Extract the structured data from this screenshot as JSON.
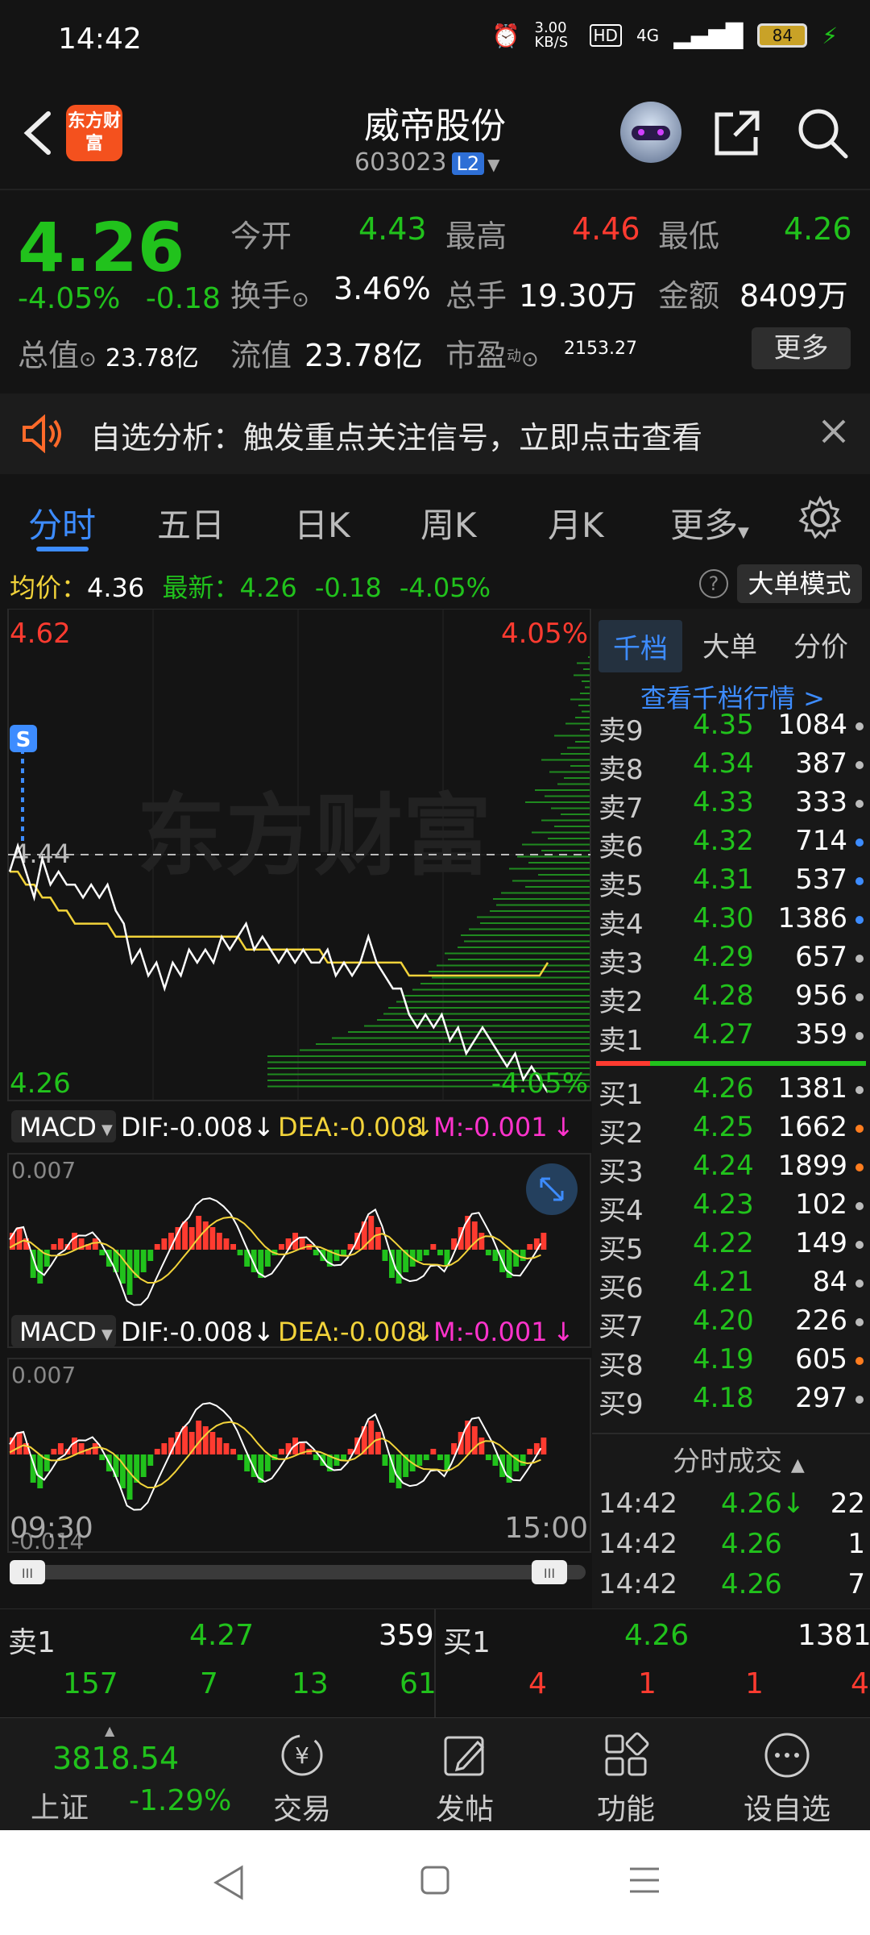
{
  "status_bar": {
    "time": "14:42",
    "net_speed": "3.00 KB/S",
    "hd": "HD",
    "signal": "4G",
    "battery": "84"
  },
  "header": {
    "logo_text": "东方财富",
    "stock_name": "威帝股份",
    "stock_code": "603023",
    "level_badge": "L2"
  },
  "quote": {
    "price": "4.26",
    "change_pct": "-4.05%",
    "change_amt": "-0.18",
    "open_label": "今开",
    "open": "4.43",
    "high_label": "最高",
    "high": "4.46",
    "low_label": "最低",
    "low": "4.26",
    "turnover_label": "换手",
    "turnover": "3.46%",
    "volume_label": "总手",
    "volume": "19.30万",
    "amount_label": "金额",
    "amount": "8409万",
    "mktcap_label": "总值",
    "mktcap": "23.78亿",
    "float_label": "流值",
    "float_cap": "23.78亿",
    "pe_label": "市盈",
    "pe_sup": "动",
    "pe": "2153.27",
    "more_button": "更多"
  },
  "notice": {
    "text": "自选分析：触发重点关注信号，立即点击查看"
  },
  "tabs": [
    "分时",
    "五日",
    "日K",
    "周K",
    "月K",
    "更多"
  ],
  "chart_header": {
    "avg_label": "均价：",
    "avg": "4.36",
    "latest_label": "最新：",
    "latest": "4.26",
    "latest_chg": "-0.18",
    "latest_pct": "-4.05%",
    "help": "?",
    "big_mode": "大单模式"
  },
  "chart_data": {
    "type": "line",
    "y_top_label": "4.62",
    "y_bottom_label": "4.26",
    "pct_top": "4.05%",
    "pct_bottom": "-4.05%",
    "prev_close": "4.44",
    "x_start": "09:30",
    "x_end": "15:00",
    "watermark": "东方财富",
    "signal_marker": "S",
    "ylim": [
      4.26,
      4.62
    ],
    "series": [
      {
        "values": [
          4.43,
          4.45,
          4.43,
          4.41,
          4.44,
          4.42,
          4.43,
          4.42,
          4.42,
          4.41,
          4.42,
          4.41,
          4.42,
          4.4,
          4.39,
          4.36,
          4.37,
          4.35,
          4.36,
          4.34,
          4.36,
          4.35,
          4.37,
          4.36,
          4.37,
          4.36,
          4.38,
          4.37,
          4.38,
          4.39,
          4.37,
          4.38,
          4.37,
          4.36,
          4.37,
          4.36,
          4.37,
          4.36,
          4.36,
          4.37,
          4.35,
          4.36,
          4.35,
          4.36,
          4.38,
          4.36,
          4.35,
          4.34,
          4.34,
          4.32,
          4.31,
          4.32,
          4.31,
          4.32,
          4.3,
          4.31,
          4.29,
          4.3,
          4.31,
          4.3,
          4.29,
          4.28,
          4.29,
          4.27,
          4.28,
          4.27,
          4.26
        ]
      },
      {
        "values": [
          4.43,
          4.43,
          4.42,
          4.42,
          4.41,
          4.41,
          4.4,
          4.4,
          4.39,
          4.39,
          4.39,
          4.39,
          4.39,
          4.38,
          4.38,
          4.38,
          4.38,
          4.38,
          4.38,
          4.38,
          4.38,
          4.38,
          4.38,
          4.38,
          4.38,
          4.38,
          4.38,
          4.38,
          4.38,
          4.37,
          4.37,
          4.37,
          4.37,
          4.37,
          4.37,
          4.37,
          4.37,
          4.37,
          4.37,
          4.36,
          4.36,
          4.36,
          4.36,
          4.36,
          4.36,
          4.36,
          4.36,
          4.36,
          4.36,
          4.35,
          4.35,
          4.35,
          4.35,
          4.35,
          4.35,
          4.35,
          4.35,
          4.35,
          4.35,
          4.35,
          4.35,
          4.35,
          4.35,
          4.35,
          4.35,
          4.35,
          4.36
        ]
      }
    ],
    "ask_depth_bars": [
      1,
      8,
      4,
      10,
      5,
      3,
      6,
      12,
      7,
      5,
      9,
      15,
      6,
      22,
      9,
      14,
      18,
      30,
      12,
      25,
      16,
      20,
      34,
      28,
      40,
      24,
      18,
      30,
      22,
      36,
      26,
      42,
      30,
      45,
      38,
      50,
      32,
      48,
      40,
      55,
      60,
      58,
      62,
      70,
      68,
      75,
      80,
      78,
      82,
      90,
      88,
      95,
      100,
      98,
      105,
      110,
      115,
      120,
      125,
      128,
      132,
      140,
      150,
      160,
      170,
      180,
      200,
      210,
      220,
      230,
      240,
      250
    ],
    "macd_label": "MACD",
    "dif": "DIF:-0.008",
    "dea": "DEA:-0.008",
    "m": "M:-0.001",
    "macd_ymax": "0.007",
    "macd_ymin": "-0.014",
    "macd_hist": [
      3,
      4,
      2,
      -5,
      -6,
      -3,
      1,
      2,
      1,
      3,
      2,
      1,
      2,
      -1,
      -3,
      -4,
      -6,
      -8,
      -5,
      -4,
      -2,
      1,
      2,
      3,
      4,
      5,
      4,
      6,
      5,
      4,
      3,
      2,
      1,
      -1,
      -3,
      -4,
      -5,
      -3,
      -1,
      1,
      2,
      3,
      2,
      1,
      -1,
      -2,
      -3,
      -2,
      -1,
      1,
      3,
      5,
      6,
      4,
      -2,
      -5,
      -6,
      -4,
      -3,
      -2,
      -1,
      1,
      -1,
      -3,
      2,
      4,
      6,
      5,
      3,
      -1,
      -2,
      -4,
      -5,
      -3,
      -2,
      1,
      2,
      3
    ]
  },
  "order_book": {
    "tabs": [
      "千档",
      "大单",
      "分价"
    ],
    "link": "查看千档行情 >",
    "asks": [
      {
        "label": "卖9",
        "price": "4.35",
        "vol": "1084",
        "dot": "#bbbbbb"
      },
      {
        "label": "卖8",
        "price": "4.34",
        "vol": "387",
        "dot": "#bbbbbb"
      },
      {
        "label": "卖7",
        "price": "4.33",
        "vol": "333",
        "dot": "#bbbbbb"
      },
      {
        "label": "卖6",
        "price": "4.32",
        "vol": "714",
        "dot": "#3d8cff"
      },
      {
        "label": "卖5",
        "price": "4.31",
        "vol": "537",
        "dot": "#3d8cff"
      },
      {
        "label": "卖4",
        "price": "4.30",
        "vol": "1386",
        "dot": "#3d8cff"
      },
      {
        "label": "卖3",
        "price": "4.29",
        "vol": "657",
        "dot": "#bbbbbb"
      },
      {
        "label": "卖2",
        "price": "4.28",
        "vol": "956",
        "dot": "#bbbbbb"
      },
      {
        "label": "卖1",
        "price": "4.27",
        "vol": "359",
        "dot": "#bbbbbb"
      }
    ],
    "bids": [
      {
        "label": "买1",
        "price": "4.26",
        "vol": "1381",
        "dot": "#bbbbbb"
      },
      {
        "label": "买2",
        "price": "4.25",
        "vol": "1662",
        "dot": "#ff7d1f"
      },
      {
        "label": "买3",
        "price": "4.24",
        "vol": "1899",
        "dot": "#ff7d1f"
      },
      {
        "label": "买4",
        "price": "4.23",
        "vol": "102",
        "dot": "#bbbbbb"
      },
      {
        "label": "买5",
        "price": "4.22",
        "vol": "149",
        "dot": "#bbbbbb"
      },
      {
        "label": "买6",
        "price": "4.21",
        "vol": "84",
        "dot": "#bbbbbb"
      },
      {
        "label": "买7",
        "price": "4.20",
        "vol": "226",
        "dot": "#bbbbbb"
      },
      {
        "label": "买8",
        "price": "4.19",
        "vol": "605",
        "dot": "#ff7d1f"
      },
      {
        "label": "买9",
        "price": "4.18",
        "vol": "297",
        "dot": "#bbbbbb"
      }
    ],
    "trades_title": "分时成交",
    "trades": [
      {
        "time": "14:42",
        "price": "4.26↓",
        "vol": "22"
      },
      {
        "time": "14:42",
        "price": "4.26",
        "vol": "1"
      },
      {
        "time": "14:42",
        "price": "4.26",
        "vol": "7"
      }
    ]
  },
  "bottom_quick": {
    "ask_label": "卖1",
    "ask_price": "4.27",
    "ask_vol": "359",
    "bid_label": "买1",
    "bid_price": "4.26",
    "bid_vol": "1381",
    "ask_queue": [
      "157",
      "7",
      "13",
      "61"
    ],
    "bid_queue": [
      "4",
      "1",
      "1",
      "4"
    ]
  },
  "bottom_nav": {
    "index_value": "3818.54",
    "index_name": "上证",
    "index_pct": "-1.29%",
    "items": [
      "交易",
      "发帖",
      "功能",
      "设自选"
    ]
  },
  "colors": {
    "up": "#ff3b30",
    "down": "#21c21c",
    "accent": "#3d8cff",
    "avg_line": "#f2d33a"
  }
}
